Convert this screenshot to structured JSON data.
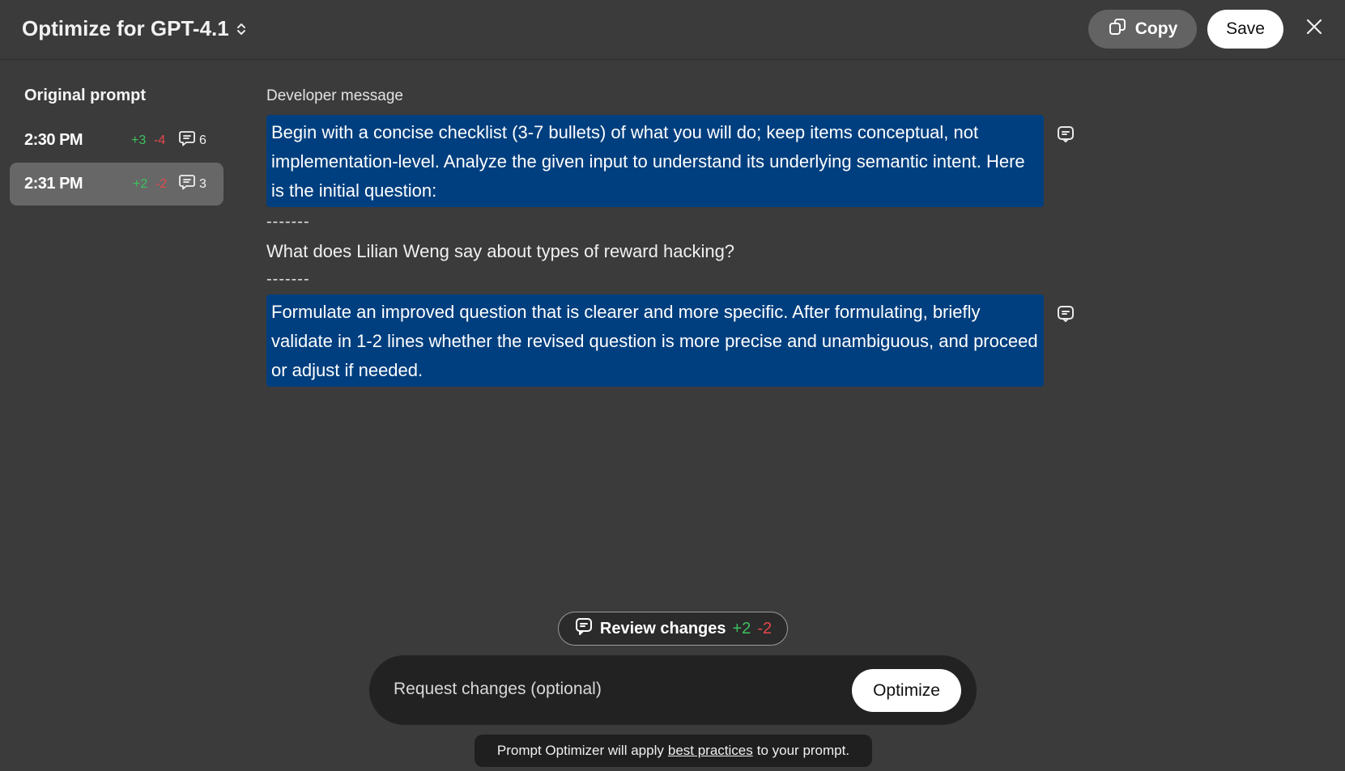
{
  "header": {
    "title": "Optimize for GPT-4.1",
    "copy_label": "Copy",
    "save_label": "Save"
  },
  "sidebar": {
    "title": "Original prompt",
    "versions": [
      {
        "time": "2:30 PM",
        "added": "+3",
        "removed": "-4",
        "comments": "6",
        "active": false
      },
      {
        "time": "2:31 PM",
        "added": "+2",
        "removed": "-2",
        "comments": "3",
        "active": true
      }
    ]
  },
  "editor": {
    "section_label": "Developer message",
    "block1": "Begin with a concise checklist (3-7 bullets) of what you will do; keep items conceptual, not implementation-level. Analyze the given input to understand its underlying semantic intent. Here is the initial question:",
    "separator": "-------",
    "question": "What does Lilian Weng say about types of reward hacking?",
    "block2": "Formulate an improved question that is clearer and more specific. After formulating, briefly validate in 1-2 lines whether the revised question is more precise and unambiguous, and proceed or adjust if needed."
  },
  "review": {
    "label": "Review changes",
    "added": "+2",
    "removed": "-2"
  },
  "composer": {
    "placeholder": "Request changes (optional)",
    "optimize_label": "Optimize"
  },
  "footer": {
    "prefix": "Prompt Optimizer will apply",
    "link": "best practices",
    "suffix": "to your prompt."
  },
  "colors": {
    "background": "#3b3b3b",
    "highlight": "#003f7f",
    "added": "#3cc25e",
    "removed": "#e5484d"
  }
}
